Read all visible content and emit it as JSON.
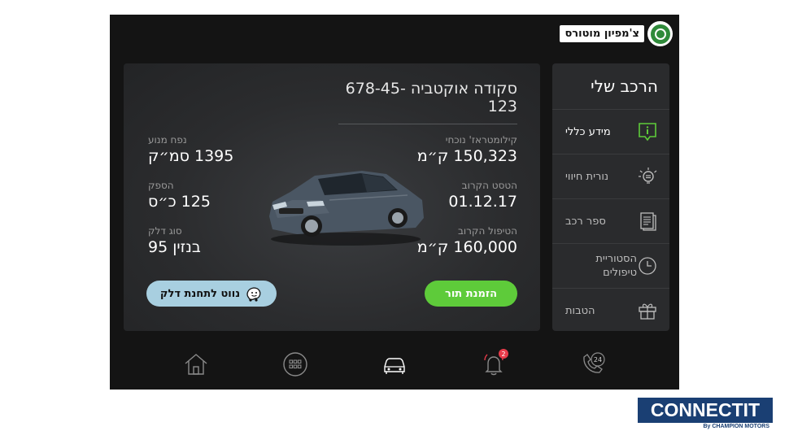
{
  "brand": {
    "name": "צ'מפיון מוטורס",
    "logo_icon": "skoda-logo-icon"
  },
  "sidebar": {
    "title": "הרכב שלי",
    "items": [
      {
        "label": "מידע כללי",
        "icon": "info-icon",
        "active": true
      },
      {
        "label": "נורית חיווי",
        "icon": "warning-light-icon",
        "active": false
      },
      {
        "label": "ספר רכב",
        "icon": "car-manual-icon",
        "active": false
      },
      {
        "label": "הסטוריית טיפולים",
        "icon": "clock-icon",
        "active": false
      },
      {
        "label": "הטבות",
        "icon": "gift-icon",
        "active": false
      }
    ]
  },
  "car": {
    "title": "סקודה אוקטביה 678-45-123",
    "stats_right": [
      {
        "label": "קילומטראז' נוכחי",
        "value": "150,323  ק״מ"
      },
      {
        "label": "הטסט הקרוב",
        "value": "01.12.17"
      },
      {
        "label": "הטיפול הקרוב",
        "value": "160,000 ק״מ"
      }
    ],
    "stats_left": [
      {
        "label": "נפח מנוע",
        "value": "1395 סמ״ק"
      },
      {
        "label": "הספק",
        "value": "125 כ״ס"
      },
      {
        "label": "סוג דלק",
        "value": "בנזין 95"
      }
    ]
  },
  "buttons": {
    "order_label": "הזמנת תור",
    "waze_label": "נווט לתחנת דלק"
  },
  "bottom_nav": {
    "items": [
      "home-icon",
      "apps-grid-icon",
      "car-icon",
      "notifications-bell-icon",
      "support-24-icon"
    ],
    "notification_count": "2",
    "support_label": "24"
  },
  "footer_logo": {
    "name": "CONNECTIT",
    "by": "By CHAMPION MOTORS"
  },
  "colors": {
    "accent_green": "#5ecb3a",
    "waze_blue": "#a8cfe0",
    "screen_bg": "#141414",
    "panel_bg": "#2a2b2d"
  }
}
